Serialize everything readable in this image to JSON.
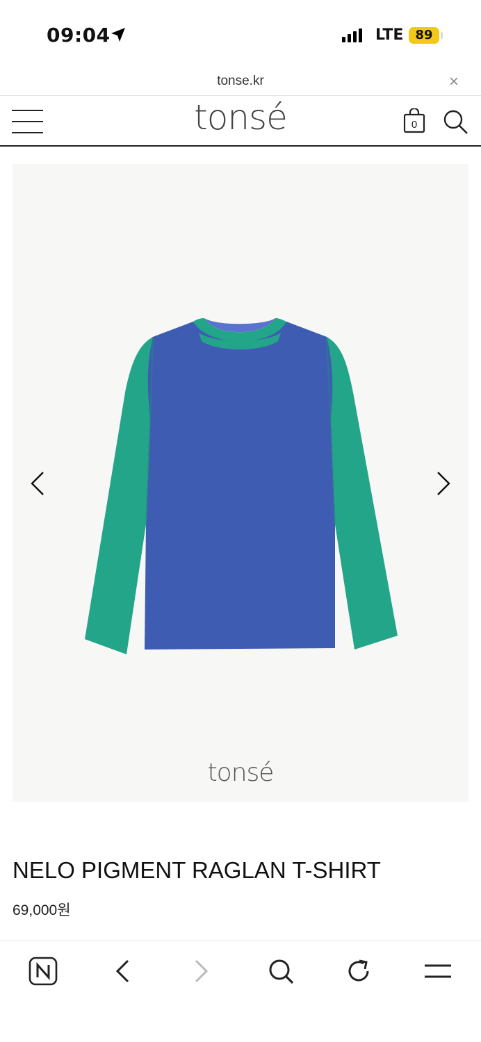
{
  "status_bar": {
    "time": "09:04",
    "network": "LTE",
    "battery": "89"
  },
  "browser": {
    "url": "tonse.kr",
    "close_label": "×"
  },
  "header": {
    "logo": "tonsé",
    "cart_count": "0"
  },
  "product": {
    "watermark": "tonsé",
    "name": "NELO PIGMENT RAGLAN T-SHIRT",
    "price": "69,000원",
    "colors": {
      "body": "#3f5cb3",
      "sleeves": "#22a68a"
    }
  },
  "icons": {
    "menu": "hamburger-icon",
    "cart": "shopping-bag-icon",
    "search": "search-icon",
    "prev": "chevron-left-icon",
    "next": "chevron-right-icon",
    "toolbar": [
      "naver-icon",
      "back-icon",
      "forward-icon",
      "search-icon",
      "refresh-icon",
      "menu-icon"
    ]
  }
}
